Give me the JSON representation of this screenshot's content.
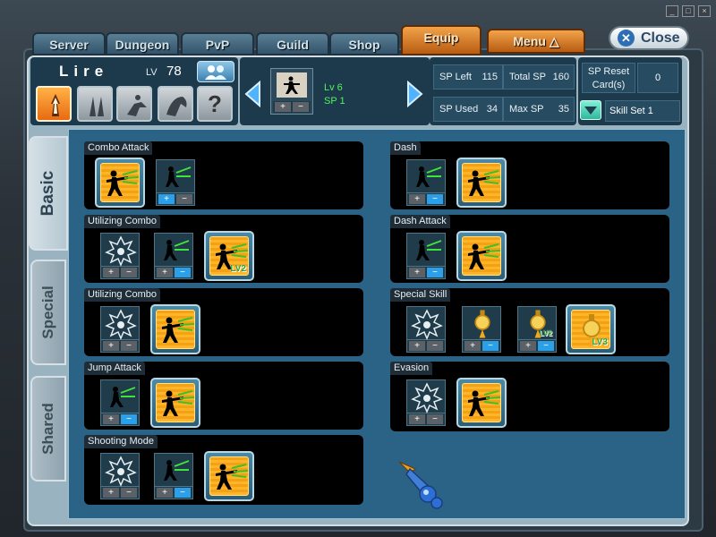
{
  "window_controls": [
    "_",
    "□",
    "×"
  ],
  "top_tabs": [
    {
      "label": "Server"
    },
    {
      "label": "Dungeon"
    },
    {
      "label": "PvP"
    },
    {
      "label": "Guild"
    },
    {
      "label": "Shop"
    },
    {
      "label": "Equip"
    },
    {
      "label": "Menu △"
    }
  ],
  "close_button": {
    "label": "Close",
    "icon": "close-x-icon"
  },
  "character": {
    "name": "Lire",
    "lv_label": "LV",
    "level": "78",
    "class_icons": [
      "fire-arrow-icon",
      "twin-blades-icon",
      "archer-pose-icon",
      "beast-icon",
      "question-icon"
    ],
    "question_glyph": "?"
  },
  "current_skill": {
    "lv_text": "Lv 6",
    "sp_text": "SP 1"
  },
  "sp_stats": {
    "sp_left_label": "SP Left",
    "sp_left": "115",
    "total_sp_label": "Total SP",
    "total_sp": "160",
    "sp_used_label": "SP Used",
    "sp_used": "34",
    "max_sp_label": "Max SP",
    "max_sp": "35"
  },
  "reset": {
    "label_line1": "SP Reset",
    "label_line2": "Card(s)",
    "value": "0",
    "skill_set": "Skill Set 1"
  },
  "side_tabs": [
    {
      "label": "Basic",
      "active": true
    },
    {
      "label": "Special",
      "active": false
    },
    {
      "label": "Shared",
      "active": false
    }
  ],
  "groups": [
    {
      "title": "Combo Attack"
    },
    {
      "title": "Utilizing Combo"
    },
    {
      "title": "Utilizing Combo"
    },
    {
      "title": "Jump Attack"
    },
    {
      "title": "Shooting Mode"
    },
    {
      "title": "Dash"
    },
    {
      "title": "Dash Attack"
    },
    {
      "title": "Special Skill"
    },
    {
      "title": "Evasion"
    }
  ],
  "pm": {
    "plus": "+",
    "minus": "−"
  },
  "level_tags": {
    "lv2": "LV2",
    "lv3": "LV3"
  },
  "colors": {
    "sp_green": "#53f25c",
    "accent_orange": "#f2a34a",
    "active_blue": "#2b9fe8"
  }
}
